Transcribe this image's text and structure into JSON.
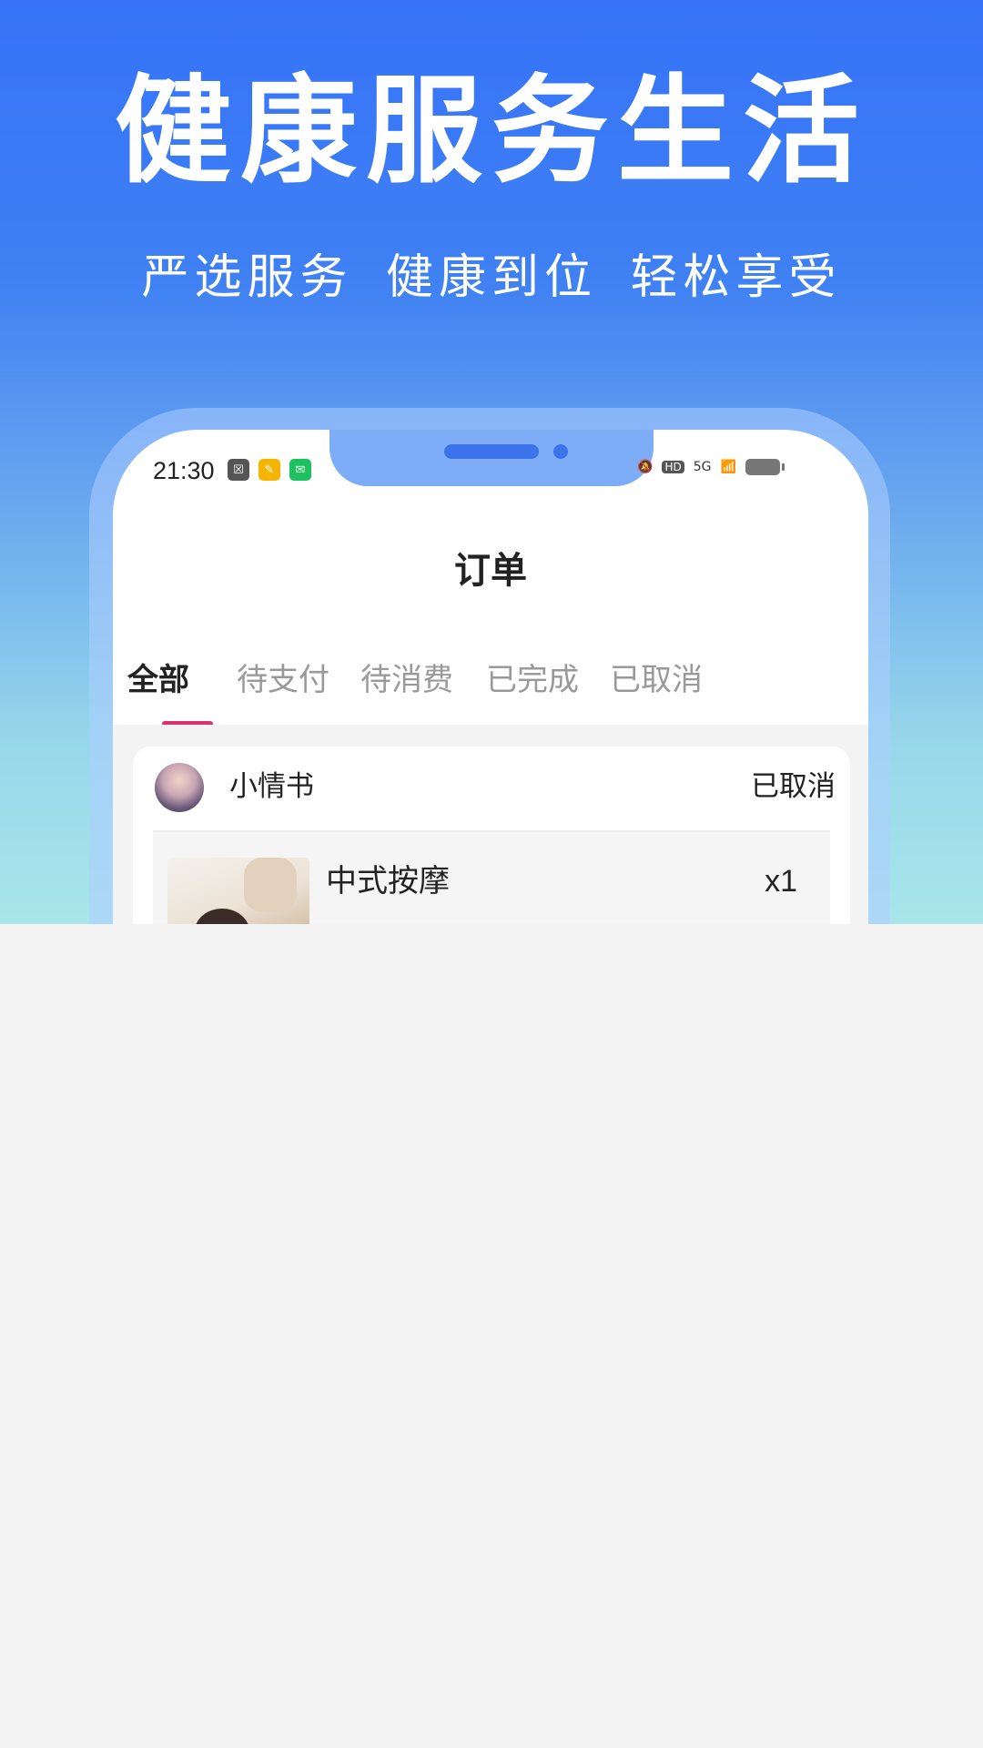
{
  "hero": {
    "title": "健康服务生活",
    "subtitle": "严选服务 健康到位 轻松享受"
  },
  "status_bar": {
    "time": "21:30",
    "network": "5G",
    "hd": "HD"
  },
  "page": {
    "title": "订单"
  },
  "tabs": [
    {
      "label": "全部",
      "active": true
    },
    {
      "label": "待支付",
      "active": false
    },
    {
      "label": "待消费",
      "active": false
    },
    {
      "label": "已完成",
      "active": false
    },
    {
      "label": "已取消",
      "active": false
    }
  ],
  "orders": [
    {
      "shop_name": "小情书",
      "status": "已取消",
      "items": [
        {
          "name": "中式按摩",
          "qty": "x1"
        }
      ]
    }
  ],
  "colors": {
    "hero_top": "#3673f9",
    "hero_bottom": "#a8e6ea",
    "tab_indicator": "#e0306a",
    "background": "#f3f3f3"
  }
}
